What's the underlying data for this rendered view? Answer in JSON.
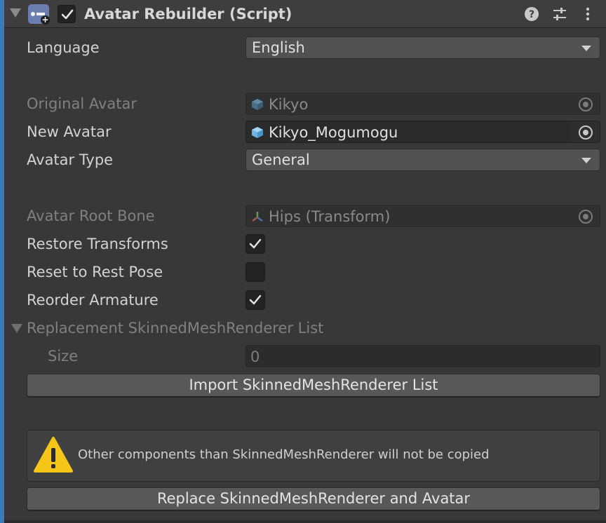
{
  "header": {
    "title": "Avatar Rebuilder (Script)",
    "enabled": true,
    "icons": [
      "component-script-icon",
      "help-icon",
      "preset-icon",
      "menu-icon"
    ]
  },
  "fields": {
    "language": {
      "label": "Language",
      "value": "English"
    },
    "original_avatar": {
      "label": "Original Avatar",
      "value": "Kikyo"
    },
    "new_avatar": {
      "label": "New Avatar",
      "value": "Kikyo_Mogumogu"
    },
    "avatar_type": {
      "label": "Avatar Type",
      "value": "General"
    },
    "avatar_root_bone": {
      "label": "Avatar Root Bone",
      "value": "Hips (Transform)"
    },
    "restore_transforms": {
      "label": "Restore Transforms",
      "checked": true
    },
    "reset_to_rest_pose": {
      "label": "Reset to Rest Pose",
      "checked": false
    },
    "reorder_armature": {
      "label": "Reorder Armature",
      "checked": true
    }
  },
  "replacement_list": {
    "label": "Replacement SkinnedMeshRenderer List",
    "size_label": "Size",
    "size_value": "0"
  },
  "buttons": {
    "import": "Import SkinnedMeshRenderer List",
    "replace": "Replace SkinnedMeshRenderer and Avatar"
  },
  "warning": {
    "message": "Other components than SkinnedMeshRenderer will not be copied"
  },
  "colors": {
    "background": "#383838",
    "selection_bar": "#3a79bb",
    "warning": "#f5c518"
  }
}
